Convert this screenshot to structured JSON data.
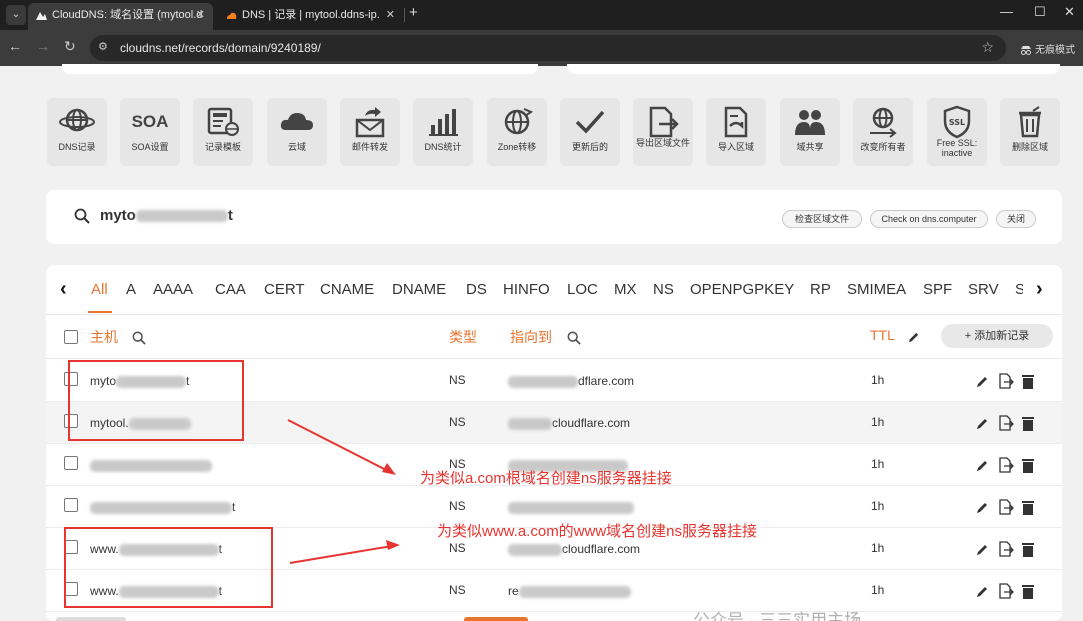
{
  "browser": {
    "tabs": [
      {
        "title": "CloudDNS: 域名设置 (mytool.d",
        "active": true
      },
      {
        "title": "DNS | 记录 | mytool.ddns-ip.",
        "active": false
      }
    ],
    "url": "cloudns.net/records/domain/9240189/",
    "incognito_label": "无痕模式"
  },
  "toolbar": [
    {
      "label": "DNS记录",
      "icon": "globe-icon"
    },
    {
      "label": "SOA设置",
      "icon": "soa-text-icon",
      "icon_text": "SOA"
    },
    {
      "label": "记录模板",
      "icon": "template-icon"
    },
    {
      "label": "云域",
      "icon": "cloud-icon"
    },
    {
      "label": "邮件转发",
      "icon": "mail-forward-icon"
    },
    {
      "label": "DNS统计",
      "icon": "bar-chart-icon"
    },
    {
      "label": "Zone转移",
      "icon": "zone-transfer-icon"
    },
    {
      "label": "更新后的",
      "icon": "checkmark-icon"
    },
    {
      "label": "导出区域文件",
      "icon": "export-file-icon"
    },
    {
      "label": "导入区域",
      "icon": "import-file-icon"
    },
    {
      "label": "域共享",
      "icon": "users-icon"
    },
    {
      "label": "改变所有者",
      "icon": "change-owner-icon"
    },
    {
      "label": "Free SSL: inactive",
      "icon": "ssl-shield-icon",
      "icon_text": "SSL"
    },
    {
      "label": "删除区域",
      "icon": "trash-icon"
    }
  ],
  "search_card": {
    "domain_visible": "myto",
    "domain_tail": "t",
    "buttons": [
      "检查区域文件",
      "Check on dns.computer",
      "关闭"
    ]
  },
  "record_types": [
    "All",
    "A",
    "AAAA",
    "CAA",
    "CERT",
    "CNAME",
    "DNAME",
    "DS",
    "HINFO",
    "LOC",
    "MX",
    "NS",
    "OPENPGPKEY",
    "RP",
    "SMIMEA",
    "SPF",
    "SRV",
    "S"
  ],
  "active_type": "All",
  "table": {
    "headers": {
      "host": "主机",
      "type": "类型",
      "points_to": "指向到",
      "ttl": "TTL"
    },
    "add_button": "+ 添加新记录",
    "rows": [
      {
        "host": "myto",
        "host_tail": "t",
        "type": "NS",
        "target": "dflare.com",
        "ttl": "1h"
      },
      {
        "host": "mytool.",
        "host_tail": "",
        "type": "NS",
        "target": "cloudflare.com",
        "ttl": "1h"
      },
      {
        "host": "",
        "host_tail": "",
        "type": "NS",
        "target": "",
        "ttl": "1h"
      },
      {
        "host": "",
        "host_tail": "t",
        "type": "NS",
        "target": "",
        "ttl": "1h"
      },
      {
        "host": "www.",
        "host_tail": "t",
        "type": "NS",
        "target": "cloudflare.com",
        "ttl": "1h"
      },
      {
        "host": "www.",
        "host_tail": "t",
        "type": "NS",
        "target": "re",
        "ttl": "1h"
      }
    ]
  },
  "annotations": {
    "first": "为类似a.com根域名创建ns服务器挂接",
    "second": "为类似www.a.com的www域名创建ns服务器挂接"
  },
  "colors": {
    "accent": "#e9742f",
    "annotation": "#e63530",
    "chrome": "#1f1f1f"
  },
  "watermark": "公众号 · 三三实用主场"
}
